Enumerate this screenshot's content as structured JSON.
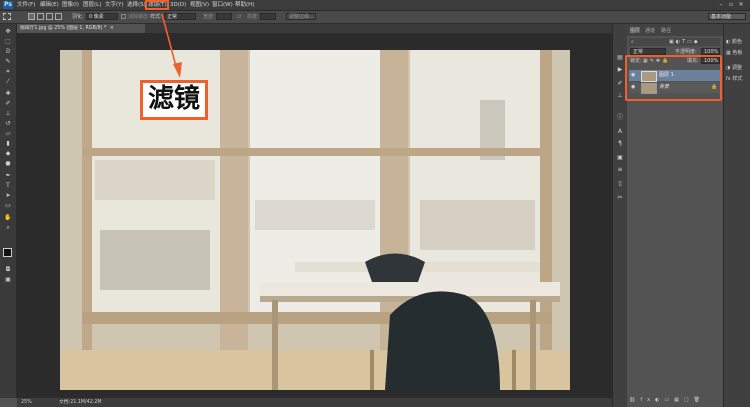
{
  "app": {
    "logo": "Ps"
  },
  "menubar": {
    "items": [
      "文件(F)",
      "编辑(E)",
      "图像(I)",
      "图层(L)",
      "文字(Y)",
      "选择(S)",
      "滤镜(T)",
      "3D(D)",
      "视图(V)",
      "窗口(W)",
      "帮助(H)"
    ],
    "window_controls": [
      "–",
      "▫",
      "✕"
    ]
  },
  "options_bar": {
    "feather_label": "羽化:",
    "feather_value": "0 像素",
    "antialias_label": "消除锯齿",
    "style_label": "样式:",
    "style_value": "正常",
    "width_label": "宽度:",
    "height_label": "高度:",
    "refine_edge": "调整边缘...",
    "workspace": "基本功能"
  },
  "document": {
    "tab_title": "咖啡厅1.jpg @ 25% (图层 1, RGB/8) *",
    "tab_close": "×"
  },
  "statusbar": {
    "zoom": "25%",
    "doc_info": "文档:21.1M/42.2M"
  },
  "layers_panel": {
    "tabs": [
      "图层",
      "通道",
      "路径"
    ],
    "blend_mode": "正常",
    "opacity_label": "不透明度:",
    "opacity_value": "100%",
    "lock_label": "锁定:",
    "fill_label": "填充:",
    "fill_value": "100%",
    "layers": [
      {
        "name": "图层 1",
        "selected": true
      },
      {
        "name": "背景",
        "selected": false
      }
    ]
  },
  "right_panel": {
    "items": [
      {
        "label": "颜色"
      },
      {
        "label": "色板"
      },
      {
        "label": "调整"
      },
      {
        "label": "样式"
      }
    ]
  },
  "annotation": {
    "label": "滤镜",
    "color": "#f0602c"
  }
}
